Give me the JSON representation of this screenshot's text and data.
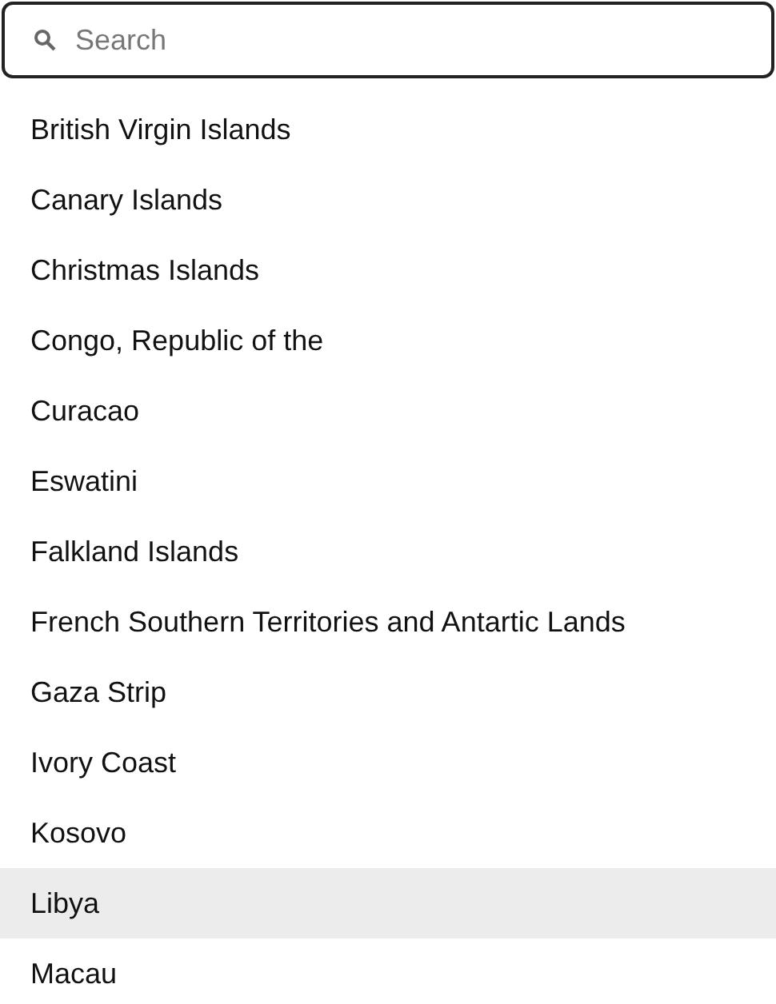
{
  "search": {
    "placeholder": "Search"
  },
  "items": [
    {
      "label": "British Virgin Islands",
      "highlighted": false
    },
    {
      "label": "Canary Islands",
      "highlighted": false
    },
    {
      "label": "Christmas Islands",
      "highlighted": false
    },
    {
      "label": "Congo, Republic of the",
      "highlighted": false
    },
    {
      "label": "Curacao",
      "highlighted": false
    },
    {
      "label": "Eswatini",
      "highlighted": false
    },
    {
      "label": "Falkland Islands",
      "highlighted": false
    },
    {
      "label": "French Southern Territories and Antartic Lands",
      "highlighted": false
    },
    {
      "label": "Gaza Strip",
      "highlighted": false
    },
    {
      "label": "Ivory Coast",
      "highlighted": false
    },
    {
      "label": "Kosovo",
      "highlighted": false
    },
    {
      "label": "Libya",
      "highlighted": true
    },
    {
      "label": "Macau",
      "highlighted": false
    }
  ]
}
